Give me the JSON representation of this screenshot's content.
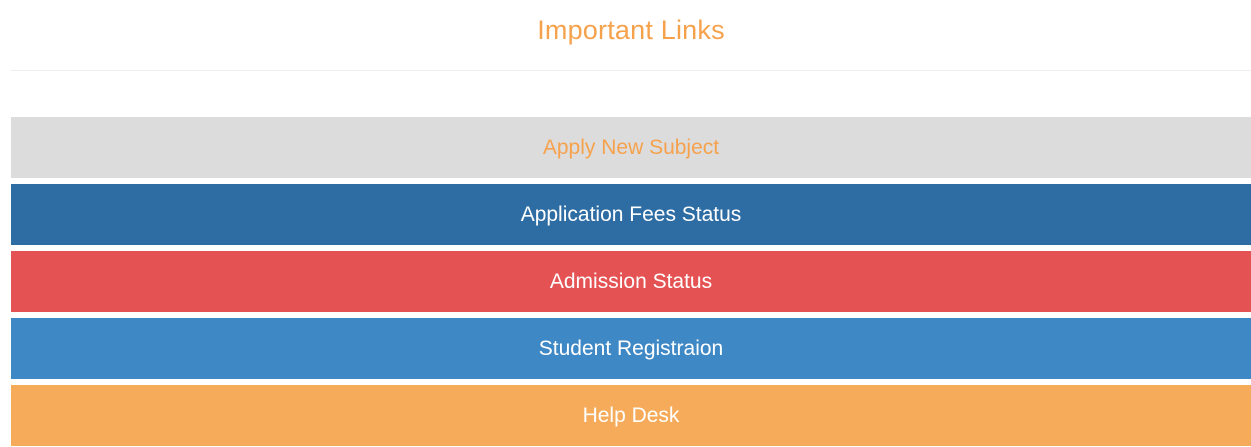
{
  "section": {
    "title": "Important Links"
  },
  "links": [
    {
      "label": "Apply New Subject",
      "background": "#dcdcdc",
      "text_color": "#f6a24d"
    },
    {
      "label": "Application Fees Status",
      "background": "#2e6da4",
      "text_color": "#ffffff"
    },
    {
      "label": "Admission Status",
      "background": "#e55253",
      "text_color": "#ffffff"
    },
    {
      "label": "Student Registraion",
      "background": "#3f88c6",
      "text_color": "#ffffff"
    },
    {
      "label": "Help Desk",
      "background": "#f5ab5a",
      "text_color": "#ffffff"
    }
  ]
}
